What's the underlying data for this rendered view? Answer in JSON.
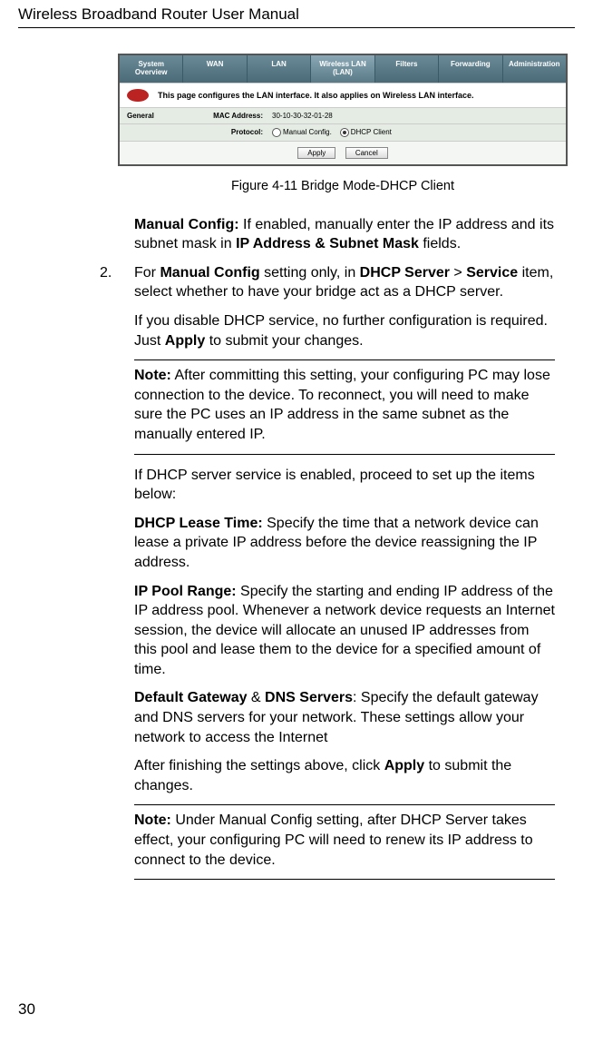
{
  "header": "Wireless Broadband Router User Manual",
  "page_number": "30",
  "figure": {
    "caption": "Figure 4-11    Bridge Mode-DHCP Client",
    "tabs": [
      "System Overview",
      "WAN",
      "LAN",
      "Wireless LAN (LAN)",
      "Filters",
      "Forwarding",
      "Administration"
    ],
    "desc": "This page configures the LAN interface. It also applies on Wireless LAN interface.",
    "general_label": "General",
    "mac_label": "MAC Address:",
    "mac_value": "30-10-30-32-01-28",
    "protocol_label": "Protocol:",
    "radio_manual": "Manual Config.",
    "radio_dhcp": "DHCP Client",
    "apply_btn": "Apply",
    "cancel_btn": "Cancel"
  },
  "body": {
    "manual_config_lead": "Manual Config:",
    "manual_config_text1": " If enabled, manually enter the IP address and its subnet mask in ",
    "manual_config_bold2": "IP Address & Subnet Mask",
    "manual_config_text2": " fields.",
    "step2_num": "2.",
    "step2_text1": "For ",
    "step2_bold1": "Manual Config",
    "step2_text2": " setting only, in ",
    "step2_bold2": "DHCP Server",
    "step2_text3": " > ",
    "step2_bold3": "Service",
    "step2_text4": " item, select whether to have your bridge act as a DHCP server.",
    "step2b_text1": "If you disable DHCP service, no further configuration is required. Just ",
    "step2b_bold1": "Apply",
    "step2b_text2": " to submit your changes.",
    "note1_lead": "Note:",
    "note1_text": " After committing this setting, your configuring PC may lose connection to the device. To reconnect, you will need to make sure the PC uses an IP address in the same subnet as the manually entered IP.",
    "dhcp_enabled_text": "If DHCP server service is enabled, proceed to set up the items below:",
    "lease_lead": "DHCP Lease Time:",
    "lease_text": " Specify the time that a network device can lease a private IP address before the device reassigning the IP address.",
    "pool_lead": "IP Pool Range:",
    "pool_text": " Specify the starting and ending IP address of the IP address pool. Whenever a network device requests an Internet session, the device will allocate an unused IP addresses from this pool and lease them to the device for a specified amount of time.",
    "gw_lead1": "Default Gateway",
    "gw_amp": " & ",
    "gw_lead2": "DNS Servers",
    "gw_text": ": Specify the default gateway and DNS servers for your network. These settings allow your network to access the Internet",
    "finish_text1": "After finishing the settings above, click ",
    "finish_bold": "Apply",
    "finish_text2": " to submit the changes.",
    "note2_lead": "Note:",
    "note2_text": " Under Manual Config setting, after DHCP Server takes effect, your configuring PC will need to renew its IP address to connect to the device."
  }
}
